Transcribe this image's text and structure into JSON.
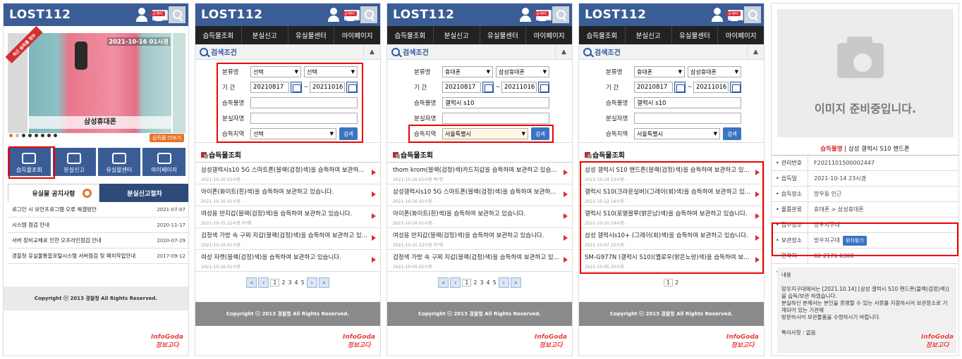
{
  "header": {
    "logo": "LOST112",
    "pc_tag": "공개PC"
  },
  "nav": [
    "습득물조회",
    "분실신고",
    "유실물센터",
    "마이페이지"
  ],
  "panel1": {
    "banner": {
      "ribbon": "최근 습득물 정보",
      "date": "2021-10-16 01시경",
      "caption": "삼성휴대폰",
      "more": "습득물 더보기"
    },
    "tiles": [
      "습득물조회",
      "분실신고",
      "유실물센터",
      "마이페이지"
    ],
    "tabs": [
      "유실물 공지사항",
      "분실신고절차"
    ],
    "notices": [
      {
        "title": "로그인 시 보안프로그램 오류 해결방안",
        "date": "2021-07-07"
      },
      {
        "title": "시스템 점검 안내",
        "date": "2020-11-17"
      },
      {
        "title": "서버 장비교체로 인한 오프라인점검 안내",
        "date": "2020-07-29"
      },
      {
        "title": "경찰청 유실물통합포털시스템 서버점검 및 패치작업안내",
        "date": "2017-09-12"
      }
    ],
    "footer": "Copyright ⓒ 2013 경찰청 All Rights Reserved."
  },
  "search": {
    "section_title": "검색조건",
    "labels": {
      "category": "분류명",
      "period": "기 간",
      "item": "습득물명",
      "owner": "분실자명",
      "region": "습득지역"
    },
    "button": "검색"
  },
  "panel2": {
    "cat1": "선택",
    "cat2": "선택",
    "date_from": "20210817",
    "date_to": "20211016",
    "item": "",
    "owner": "",
    "region": "선택",
    "results_title": "습득물조회",
    "results": [
      {
        "title": "삼성갤럭시s10 5G 스마트폰(블랙(검정)색)을 습득하여 보관하...",
        "date": "2021-10-16 01시경 -"
      },
      {
        "title": "아이폰(화이트(흰)색)을 습득하여 보관하고 있습니다.",
        "date": "2021-10-16 01시경 -"
      },
      {
        "title": "여성용 반지갑(블랙(검정)색)을 습득하여 보관하고 있습니다.",
        "date": "2021-10-15 22시경 이*희"
      },
      {
        "title": "검정색 가방 속 구찌 지갑(블랙(검정)색)을 습득하여 보관하고 있...",
        "date": "2021-10-16 01시경 -"
      },
      {
        "title": "여성 자켓(블랙(검정)색)을 습득하여 보관하고 있습니다.",
        "date": "2021-10-16 01시경 -"
      }
    ],
    "pages": [
      "1",
      "2",
      "3",
      "4",
      "5"
    ],
    "footer": "Copyright ⓒ 2013 경찰청 All Rights Reserved."
  },
  "panel3": {
    "cat1": "휴대폰",
    "cat2": "삼성휴대폰",
    "date_from": "20210817",
    "date_to": "20211016",
    "item": "갤럭시 s10",
    "owner": "",
    "region": "서울특별시",
    "results_title": "습득물조회",
    "results": [
      {
        "title": "thom krom(블랙(검정)색)카드지갑을 습득하여 보관하고 있습니...",
        "date": "2021-10-16 01시경 박*정"
      },
      {
        "title": "삼성갤럭시s10 5G 스마트폰(블랙(검정)색)을 습득하여 보관하...",
        "date": "2021-10-16 01시경 -"
      },
      {
        "title": "아이폰(화이트(흰)색)을 습득하여 보관하고 있습니다.",
        "date": "2021-10-16 01시경 -"
      },
      {
        "title": "여성용 반지갑(블랙(검정)색)을 습득하여 보관하고 있습니다.",
        "date": "2021-10-15 22시경 이*희"
      },
      {
        "title": "검정색 가방 속 구찌 지갑(블랙(검정)색)을 습득하여 보관하고 있...",
        "date": "2021-10-05 01시경 -"
      }
    ],
    "pages": [
      "1",
      "2",
      "3",
      "4",
      "5"
    ],
    "footer": "Copyright ⓒ 2013 경찰청 All Rights Reserved."
  },
  "panel4": {
    "cat1": "휴대폰",
    "cat2": "삼성휴대폰",
    "date_from": "20210817",
    "date_to": "20211016",
    "item": "갤럭시 s10",
    "owner": "",
    "region": "서울특별시",
    "results_title": "습득물조회",
    "results": [
      {
        "title": "삼성 갤럭시 S10 핸드폰(블랙(검정)색)을 습득하여 보관하고 있...",
        "date": "2021-10-14 23시경 -"
      },
      {
        "title": "갤럭시 S10(크라운실버)(그레이(회)색)을 습득하여 보관하고 있...",
        "date": "2021-10-12 16시경 -"
      },
      {
        "title": "갤럭시 S10(로열블루(밝은남)색)을 습득하여 보관하고 있습니다.",
        "date": "2021-10-10 19시경 -"
      },
      {
        "title": "삼성 갤럭시s10+ (그레이(회)색)을 습득하여 보관하고 있습니다.",
        "date": "2021-10-07 22시경 -"
      },
      {
        "title": "SM-G977N (갤럭시 S10)(옐로우(밝은노랑)색)을 습득하여 보관...",
        "date": "2021-10-05 20시경 -"
      }
    ],
    "pages": [
      "1",
      "2"
    ],
    "footer": "Copyright ⓒ 2013 경찰청 All Rights Reserved."
  },
  "panel5": {
    "no_image": "이미지 준비중입니다.",
    "title_label": "습득물명",
    "title_value": "삼성 갤럭시 S10 핸드폰",
    "rows": [
      {
        "k": "관리번호",
        "v": "F2021101500002447"
      },
      {
        "k": "습득일",
        "v": "2021-10-14 23시경"
      },
      {
        "k": "습득장소",
        "v": "망우동 인근"
      },
      {
        "k": "물품분류",
        "v": "휴대폰 > 삼성휴대폰"
      },
      {
        "k": "접수장소",
        "v": "망우지구대"
      },
      {
        "k": "보관장소",
        "v": "망우지구대"
      },
      {
        "k": "연락처",
        "v": "02-2171-0300"
      },
      {
        "k": "특이사항",
        "v": ""
      }
    ],
    "locate_button": "위치찾기",
    "memo_label": "내용",
    "memo_body": "망우지구대에서는 [2021.10.14] [삼성 갤럭시 S10 핸드폰(블랙(검정)색)]을 습득/보관 하였습니다.\n분실하신 분께서는 본인을 증명할 수 있는 서류를 지참하시어 보관장소로 기재되어 있는 기관에\n방문하시어 보관물품을 수령하시기 바랍니다.",
    "memo_extra": "특이사항 : 없음"
  },
  "watermark": "InfoGoda 정보고다",
  "colors": {
    "header": "#3a5d96",
    "highlight": "#e00000",
    "accent": "#d32f2f"
  }
}
